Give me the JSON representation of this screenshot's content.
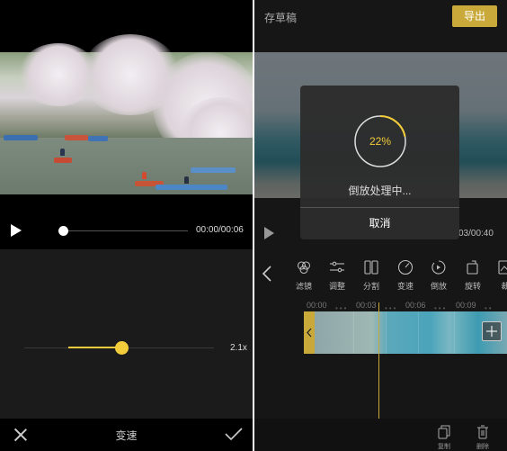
{
  "left": {
    "playback_time": "00:00/00:06",
    "playback_progress": 0,
    "speed_value_label": "2.1x",
    "speed_level": 0.52,
    "footer_title": "变速"
  },
  "right": {
    "draft_label": "存草稿",
    "export_label": "导出",
    "playback_time": "03/00:40",
    "dialog": {
      "progress_percent_label": "22%",
      "progress": 0.22,
      "processing_text": "倒放处理中...",
      "cancel_label": "取消"
    },
    "tools": [
      {
        "icon": "filter-icon",
        "label": "滤镜"
      },
      {
        "icon": "adjust-icon",
        "label": "调整"
      },
      {
        "icon": "split-icon",
        "label": "分割"
      },
      {
        "icon": "speed-icon",
        "label": "变速"
      },
      {
        "icon": "reverse-icon",
        "label": "倒放"
      },
      {
        "icon": "rotate-icon",
        "label": "旋转"
      },
      {
        "icon": "crop-icon",
        "label": "裁"
      }
    ],
    "ruler_labels": [
      "00:00",
      "00:03",
      "00:06",
      "00:09"
    ],
    "footer_tools": [
      {
        "icon": "copy-icon",
        "label": "复制"
      },
      {
        "icon": "delete-icon",
        "label": "删除"
      }
    ]
  },
  "colors": {
    "accent": "#f2cc3a",
    "export_button": "#c9a93a"
  }
}
